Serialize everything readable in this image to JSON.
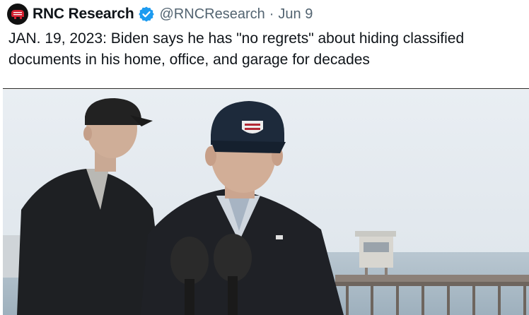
{
  "tweet": {
    "author": {
      "display_name": "RNC Research",
      "handle": "@RNCResearch",
      "verified": true,
      "avatar_icon": "gop-elephant-icon",
      "avatar_color": "#d1202f"
    },
    "separator": "·",
    "date": "Jun 9",
    "text": "JAN. 19, 2023: Biden says he has \"no regrets\" about hiding classified documents in his home, office, and garage for decades"
  },
  "colors": {
    "verified_badge": "#1d9bf0",
    "secondary_text": "#536471",
    "primary_text": "#0f1419"
  },
  "media": {
    "type": "video-still",
    "icons": [
      "microphone-icon"
    ]
  }
}
